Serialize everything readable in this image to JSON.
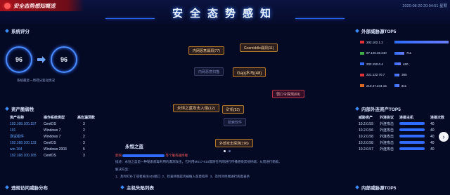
{
  "header": {
    "brand": "安全态势感知概览",
    "title": "安全态势感知",
    "datetime": "2020-08-20 20:04:51 星期"
  },
  "score": {
    "section_title": "系统评分",
    "before": "96",
    "after": "96",
    "note": "系统最近一周得分变化情况"
  },
  "assets": {
    "section_title": "资产脆弱性",
    "columns": [
      "资产名称",
      "操作系统类型",
      "高危漏洞数"
    ],
    "rows": [
      [
        "192.168.100.157",
        "CentOS",
        "3"
      ],
      [
        "191",
        "Windows 7",
        "2"
      ],
      [
        "测试组件",
        "Windows 7",
        "2"
      ],
      [
        "192.168.100.133",
        "CentOS",
        "3"
      ],
      [
        "win-164",
        "Windows 2003",
        "5"
      ],
      [
        "192.168.100.165",
        "CentOS",
        "3"
      ]
    ]
  },
  "center": {
    "bubbles": [
      {
        "label": "内网恶意漏洞(77)",
        "style": "orange"
      },
      {
        "label": "Gosmiddle漏洞(11)",
        "style": "orange"
      },
      {
        "label": "内网恶意扫描",
        "style": "dim"
      },
      {
        "label": "Gapj木马(48)",
        "style": "orange"
      },
      {
        "label": "弱口令探测(69)",
        "style": "red"
      },
      {
        "label": "永恒之蓝攻击入侵(12)",
        "style": "orange"
      },
      {
        "label": "矿机(52)",
        "style": "orange"
      },
      {
        "label": "勒索软件",
        "style": "dim"
      },
      {
        "label": "外部攻击探测(196)",
        "style": "orange"
      }
    ],
    "panel": {
      "title": "永恒之蓝",
      "alert_prefix": "影响",
      "alert_suffix": "等个服务器终端",
      "desc_prefix": "描述：",
      "desc": "永恒之蓝是一种勒索病毒利用的漏洞攻击，它利用MS17-010漏洞在内网进行传播感染其他终端，从而进行勒索。",
      "solution_title": "解决方案：",
      "solution_1": "1、及时打补丁或者关闭445端口",
      "solution_2": "2、检查终端是否被植入恶意程序",
      "solution_3": "3、及时对终端进行病毒查杀"
    }
  },
  "bottom": {
    "left_title": "违规访问威胁分布",
    "center_title": "主机失陷列表"
  },
  "top5_external": {
    "section_title": "外部威胁源TOP5",
    "colors": [
      "#e0303a",
      "#3fae4a",
      "#2f6cff",
      "#e0303a",
      "#e06a20"
    ]
  },
  "chart_data": {
    "type": "bar",
    "title": "外部威胁源TOP5",
    "categories": [
      "202.102.1.2",
      "87.126.36.240",
      "202.150.0.4",
      "221.122.70.7",
      "210.47.244.15"
    ],
    "values": [
      3927,
      711,
      460,
      365,
      341
    ],
    "xlim": [
      0,
      4000
    ]
  },
  "outbound": {
    "section_title": "内部外连资产TOP5",
    "columns": [
      "威胁资产",
      "外连协议",
      "连接主机",
      "连接次数"
    ],
    "rows": [
      [
        "10.2.0.59",
        "外连攻击",
        "",
        "40"
      ],
      [
        "10.2.0.56",
        "外连攻击",
        "",
        "40"
      ],
      [
        "10.2.0.58",
        "外连攻击",
        "",
        "40"
      ],
      [
        "10.2.0.58",
        "外连攻击",
        "",
        "40"
      ],
      [
        "10.2.0.57",
        "外连攻击",
        "",
        "40"
      ]
    ]
  },
  "internal_top5": {
    "section_title": "内部威胁源TOP5"
  },
  "nav": {
    "prev": "‹",
    "next": "›"
  }
}
